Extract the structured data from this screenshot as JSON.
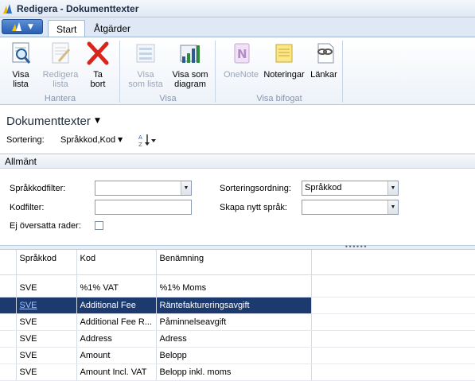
{
  "window": {
    "title": "Redigera - Dokumenttexter"
  },
  "tabs": [
    {
      "label": "Start"
    },
    {
      "label": "Åtgärder"
    }
  ],
  "ribbon": {
    "groups": {
      "hantera": {
        "label": "Hantera",
        "buttons": [
          {
            "line1": "Visa",
            "line2": "lista",
            "icon": "magnifier-list-icon"
          },
          {
            "line1": "Redigera",
            "line2": "lista",
            "icon": "edit-list-icon"
          },
          {
            "line1": "Ta",
            "line2": "bort",
            "icon": "delete-x-icon"
          }
        ]
      },
      "visa": {
        "label": "Visa",
        "buttons": [
          {
            "line1": "Visa",
            "line2": "som lista",
            "icon": "list-view-icon"
          },
          {
            "line1": "Visa som",
            "line2": "diagram",
            "icon": "chart-view-icon"
          }
        ]
      },
      "visa_bifogat": {
        "label": "Visa bifogat",
        "buttons": [
          {
            "line1": "OneNote",
            "icon": "onenote-icon"
          },
          {
            "line1": "Noteringar",
            "icon": "notes-icon"
          },
          {
            "line1": "Länkar",
            "icon": "links-icon"
          }
        ]
      }
    }
  },
  "page": {
    "title": "Dokumenttexter",
    "sort_label": "Sortering:",
    "sort_value": "Språkkod,Kod"
  },
  "section": {
    "title": "Allmänt",
    "fields": {
      "sprakkodfilter_label": "Språkkodfilter:",
      "sprakkodfilter_value": "",
      "kodfilter_label": "Kodfilter:",
      "kodfilter_value": "",
      "ej_oversatta_label": "Ej översatta rader:",
      "ej_oversatta_checked": false,
      "sorteringsordning_label": "Sorteringsordning:",
      "sorteringsordning_value": "Språkkod",
      "skapa_nytt_sprak_label": "Skapa nytt språk:",
      "skapa_nytt_sprak_value": ""
    }
  },
  "grid": {
    "columns": [
      "Språkkod",
      "Kod",
      "Benämning"
    ],
    "rows": [
      {
        "lang": "SVE",
        "code": "%1% VAT",
        "desc": "%1% Moms"
      },
      {
        "lang": "SVE",
        "code": "Additional Fee",
        "desc": "Räntefaktureringsavgift"
      },
      {
        "lang": "SVE",
        "code": "Additional Fee R...",
        "desc": "Påminnelseavgift"
      },
      {
        "lang": "SVE",
        "code": "Address",
        "desc": "Adress"
      },
      {
        "lang": "SVE",
        "code": "Amount",
        "desc": "Belopp"
      },
      {
        "lang": "SVE",
        "code": "Amount Incl. VAT",
        "desc": "Belopp inkl. moms"
      }
    ],
    "selected_row_index": 1
  },
  "colors": {
    "selection": "#1c3a6e",
    "ribbon_bg": "#edf2f9",
    "delete_red": "#d8261c"
  }
}
